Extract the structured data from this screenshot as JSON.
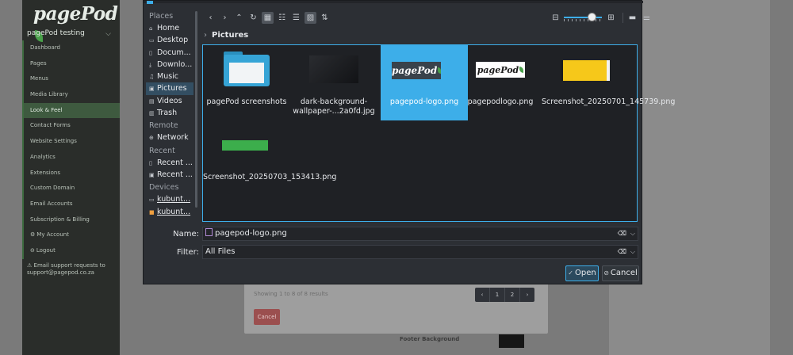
{
  "app": {
    "logo": "pagePod",
    "site": "pagePod testing",
    "nav": [
      {
        "label": "Dashboard",
        "icon": ""
      },
      {
        "label": "Pages",
        "icon": ""
      },
      {
        "label": "Menus",
        "icon": ""
      },
      {
        "label": "Media Library",
        "icon": ""
      },
      {
        "label": "Look & Feel",
        "icon": "",
        "active": true
      },
      {
        "label": "Contact Forms",
        "icon": ""
      },
      {
        "label": "Website Settings",
        "icon": ""
      },
      {
        "label": "Analytics",
        "icon": ""
      },
      {
        "label": "Extensions",
        "icon": ""
      },
      {
        "label": "Custom Domain",
        "icon": ""
      },
      {
        "label": "Email Accounts",
        "icon": ""
      },
      {
        "label": "Subscription & Billing",
        "icon": ""
      },
      {
        "label": "My Account",
        "icon": "gear-icon"
      },
      {
        "label": "Logout",
        "icon": "logout-icon"
      }
    ],
    "support": [
      "Email support requests to",
      "support@pagepod.co.za"
    ],
    "panel": {
      "results": "Showing 1 to 8 of 8 results",
      "pager": [
        "‹",
        "1",
        "2",
        "›"
      ],
      "cancel": "Cancel"
    },
    "footer_background_label": "Footer Background"
  },
  "dialog": {
    "places": {
      "sections": {
        "places": "Places",
        "remote": "Remote",
        "recent": "Recent",
        "devices": "Devices"
      },
      "places_items": [
        "Home",
        "Desktop",
        "Docum...",
        "Downlo...",
        "Music",
        "Pictures",
        "Videos",
        "Trash"
      ],
      "remote_items": [
        "Network"
      ],
      "recent_items": [
        "Recent ...",
        "Recent ..."
      ],
      "device_items": [
        "kubunt...",
        "kubunt..."
      ]
    },
    "breadcrumb": "Pictures",
    "files": [
      {
        "name": "pagePod screenshots",
        "kind": "folder"
      },
      {
        "name": "dark-background-wallpaper-...2a0fd.jpg",
        "kind": "image-dark"
      },
      {
        "name": "pagepod-logo.png",
        "kind": "logo-dark",
        "selected": true
      },
      {
        "name": "pagepodlogo.png",
        "kind": "logo-light"
      },
      {
        "name": "Screenshot_20250701_145739.png",
        "kind": "image-yellow"
      },
      {
        "name": "Screenshot_20250703_153413.png",
        "kind": "image-green"
      }
    ],
    "name_label": "Name:",
    "name_value": "pagepod-logo.png",
    "filter_label": "Filter:",
    "filter_value": "All Files",
    "open_label": "Open",
    "cancel_label": "Cancel"
  }
}
